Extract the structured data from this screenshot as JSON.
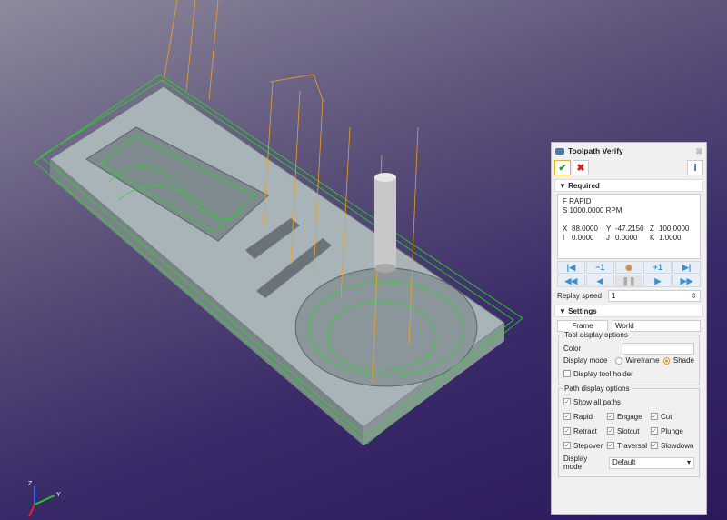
{
  "panel": {
    "title": "Toolpath Verify",
    "close": "⊠",
    "ok": "✔",
    "cancel": "✖",
    "info": "i"
  },
  "required": {
    "label": "Required",
    "f": "F  RAPID",
    "s": "S 1000.0000 RPM",
    "coords": [
      [
        "X",
        "88.0000",
        "Y",
        "-47.2150",
        "Z",
        "100.0000"
      ],
      [
        "I",
        "0.0000",
        "J",
        "0.0000",
        "K",
        "1.0000"
      ]
    ],
    "controls": [
      "first-icon",
      "-1",
      "toolpath-icon",
      "+1",
      "last-icon",
      "rewind-icon",
      "step-back-icon",
      "pause-icon",
      "play-icon",
      "fast-forward-icon"
    ],
    "minus1": "−1",
    "plus1": "+1",
    "replay_label": "Replay speed",
    "replay_value": "1"
  },
  "settings": {
    "label": "Settings",
    "frame_label": "Frame",
    "frame_value": "World",
    "tool_group": "Tool display options",
    "color_label": "Color",
    "mode_label": "Display mode",
    "wireframe": "Wireframe",
    "shade": "Shade",
    "shade_selected": true,
    "holder": "Display tool holder",
    "holder_checked": false,
    "path_group": "Path display options",
    "show_all": "Show all paths",
    "paths": [
      "Rapid",
      "Engage",
      "Cut",
      "Retract",
      "Slotcut",
      "Plunge",
      "Stepover",
      "Traversal",
      "Slowdown"
    ],
    "path_mode_label": "Display mode",
    "path_mode_value": "Default"
  },
  "axes": {
    "y": "Y",
    "z": "Z"
  },
  "colors": {
    "cut": "#22dd22",
    "rapid": "#f0a020",
    "accent": "#3a90d0"
  }
}
